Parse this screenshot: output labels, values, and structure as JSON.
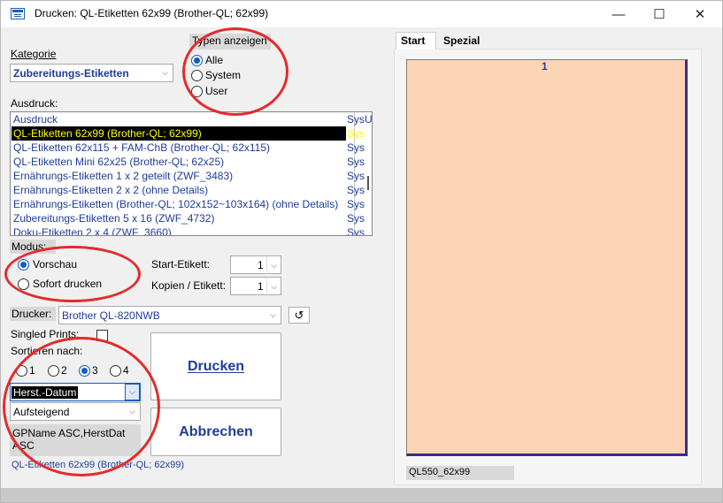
{
  "window": {
    "title": "Drucken: QL-Etiketten 62x99 (Brother-QL; 62x99)",
    "minimize": "—",
    "maximize": "☐",
    "close": "✕"
  },
  "kategorie": {
    "label": "Kategorie",
    "value": "Zubereitungs-Etiketten"
  },
  "typen": {
    "label": "Typen anzeigen",
    "options": [
      "Alle",
      "System",
      "User"
    ],
    "selected": "Alle"
  },
  "ausdruck": {
    "label": "Ausdruck:",
    "header": [
      "Ausdruck",
      "SysU"
    ],
    "rows": [
      [
        "QL-Etiketten 62x99 (Brother-QL; 62x99)",
        "Sys"
      ],
      [
        "QL-Etiketten 62x115 + FAM-ChB (Brother-QL; 62x115)",
        "Sys"
      ],
      [
        "QL-Etiketten Mini 62x25 (Brother-QL; 62x25)",
        "Sys"
      ],
      [
        "Ernährungs-Etiketten 1 x 2 geteilt (ZWF_3483)",
        "Sys"
      ],
      [
        "Ernährungs-Etiketten 2 x 2 (ohne Details)",
        "Sys"
      ],
      [
        "Ernährungs-Etiketten (Brother-QL; 102x152~103x164) (ohne Details)",
        "Sys"
      ],
      [
        "Zubereitungs-Etiketten 5 x 16 (ZWF_4732)",
        "Sys"
      ],
      [
        "Doku-Etiketten 2 x 4 (ZWF_3660)",
        "Sys"
      ]
    ],
    "selected_index": 0
  },
  "modus": {
    "label": "Modus:",
    "options": [
      "Vorschau",
      "Sofort drucken"
    ],
    "selected": "Vorschau"
  },
  "start_etikett": {
    "label": "Start-Etikett:",
    "value": "1"
  },
  "kopien": {
    "label": "Kopien / Etikett:",
    "value": "1"
  },
  "drucker": {
    "label": "Drucker:",
    "value": "Brother QL-820NWB",
    "refresh": "↺"
  },
  "singled_prints": {
    "label": "Singled Prints:",
    "checked": false
  },
  "sortieren": {
    "label": "Sortieren nach:",
    "options": [
      "1",
      "2",
      "3",
      "4"
    ],
    "selected": "3",
    "field": "Herst.-Datum",
    "order": "Aufsteigend",
    "summary": "GPName ASC,HerstDat ASC"
  },
  "buttons": {
    "drucken": "Drucken",
    "abbrechen": "Abbrechen"
  },
  "status_text": "QL-Etiketten 62x99 (Brother-QL; 62x99)",
  "tabs": [
    "Start",
    "Spezial"
  ],
  "preview": {
    "page_number": "1",
    "caption": "QL550_62x99"
  },
  "colors": {
    "accent": "#1f3c9b",
    "selection_bg": "#000000",
    "selection_fg": "#ffff00",
    "preview_bg": "#fcd5b4",
    "annotation": "#e32b2b"
  }
}
